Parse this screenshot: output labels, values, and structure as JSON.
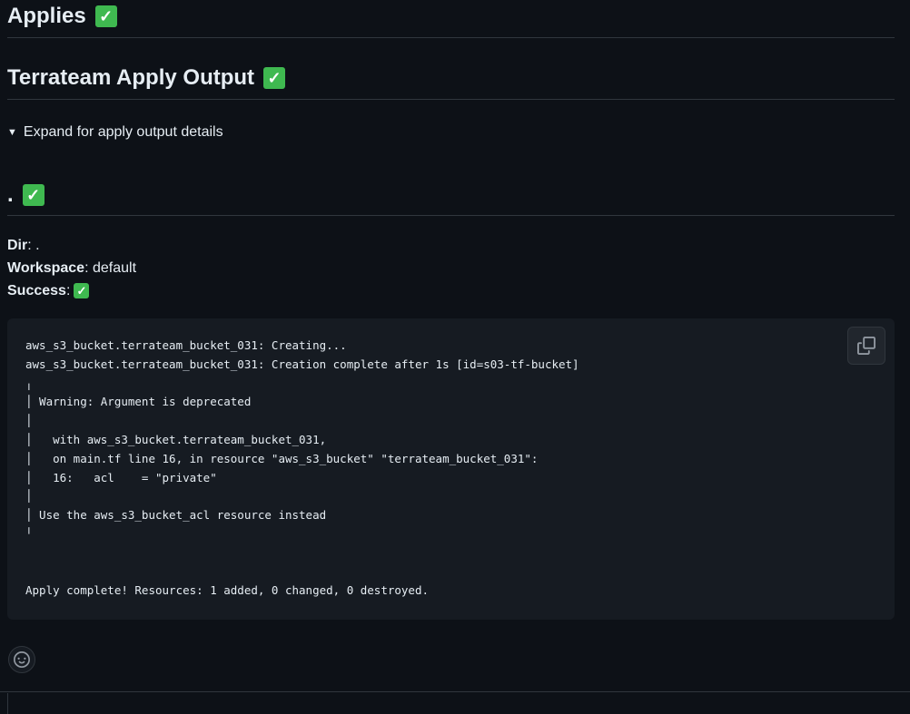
{
  "headings": {
    "applies": "Applies",
    "apply_output": "Terrateam Apply Output",
    "dir_heading": "."
  },
  "status_icon": "check-mark-icon",
  "details": {
    "summary": "Expand for apply output details"
  },
  "meta": {
    "dir_label": "Dir",
    "dir_value": ": .",
    "workspace_label": "Workspace",
    "workspace_value": ": default",
    "success_label": "Success",
    "success_sep": ":"
  },
  "code_output": "aws_s3_bucket.terrateam_bucket_031: Creating...\naws_s3_bucket.terrateam_bucket_031: Creation complete after 1s [id=s03-tf-bucket]\n╷\n│ Warning: Argument is deprecated\n│\n│   with aws_s3_bucket.terrateam_bucket_031,\n│   on main.tf line 16, in resource \"aws_s3_bucket\" \"terrateam_bucket_031\":\n│   16:   acl    = \"private\"\n│\n│ Use the aws_s3_bucket_acl resource instead\n╵\n\n\nApply complete! Resources: 1 added, 0 changed, 0 destroyed.",
  "icons": {
    "copy": "copy-icon",
    "reaction": "smiley-icon",
    "expand": "triangle-down-icon"
  },
  "colors": {
    "background": "#0d1117",
    "code_background": "#161b22",
    "check_green": "#3fb950",
    "border": "#30363d",
    "text": "#e6edf3"
  }
}
